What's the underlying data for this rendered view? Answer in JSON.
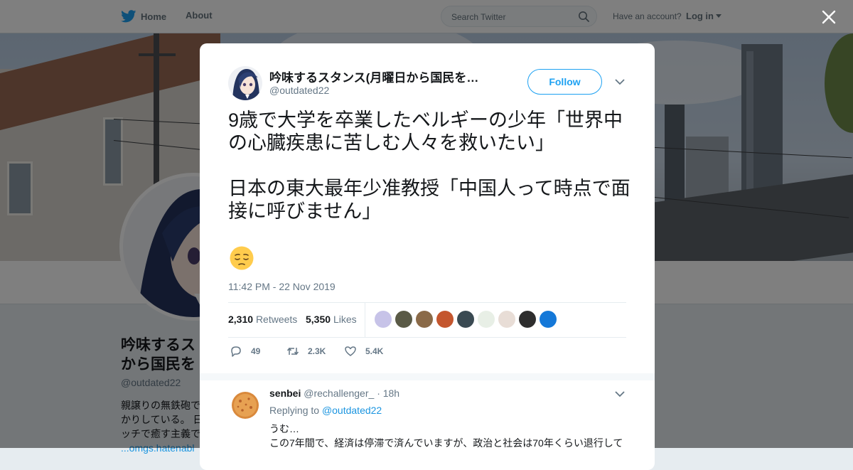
{
  "nav": {
    "home_label": "Home",
    "about_label": "About",
    "search_placeholder": "Search Twitter",
    "have_account": "Have an account?",
    "login_label": "Log in"
  },
  "profile": {
    "name": "吟味するスタンス(月曜日から国民を守る)",
    "name_visible_line1": "吟味するス",
    "name_visible_line2": "から国民を",
    "handle": "@outdated22",
    "bio_line1": "親譲りの無鉄砲で",
    "bio_line2": "かりしている。 日",
    "bio_line3": "ッチで癒す主義で",
    "bio_link": "...omgs.hatenabl"
  },
  "tweet": {
    "author_name": "吟味するスタンス(月曜日から国民を…",
    "author_handle": "@outdated22",
    "follow_label": "Follow",
    "text": "9歳で大学を卒業したベルギーの少年「世界中の心臓疾患に苦しむ人々を救いたい」\n\n日本の東大最年少准教授「中国人って時点で面接に呼びません」",
    "emoji": "pensive-face",
    "timestamp": "11:42 PM - 22 Nov 2019",
    "retweets_count": "2,310",
    "retweets_label": "Retweets",
    "likes_count": "5,350",
    "likes_label": "Likes",
    "liker_colors": [
      "#c7c3e8",
      "#5a5a46",
      "#8a6a48",
      "#c4562e",
      "#3a4a52",
      "#e8efe6",
      "#e8ddd6",
      "#2e2e2e",
      "#1478d8"
    ],
    "replies_action": "49",
    "retweets_action": "2.3K",
    "likes_action": "5.4K"
  },
  "reply": {
    "name": "senbei",
    "handle": "@rechallenger_",
    "time": "· 18h",
    "replying_prefix": "Replying to",
    "replying_to": "@outdated22",
    "text_line1": "うむ…",
    "text_line2": "この7年間で、経済は停滞で済んでいますが、政治と社会は70年くらい退行して"
  },
  "colors": {
    "twitter_blue": "#1da1f2",
    "link_blue": "#1b95e0",
    "muted": "#657786",
    "overlay": "rgba(0,0,0,0.5)"
  }
}
